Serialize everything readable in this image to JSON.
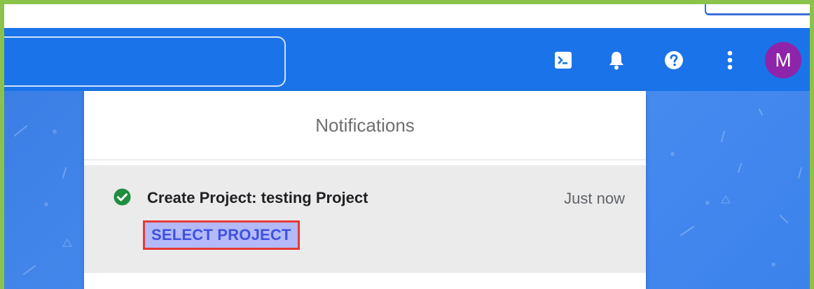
{
  "header": {
    "icons": {
      "terminal": "terminal-icon",
      "notifications": "bell-icon",
      "help": "help-icon",
      "more": "more-vert-icon"
    },
    "avatar_initial": "M",
    "colors": {
      "header": "#1a73e8",
      "avatar": "#8e24aa"
    }
  },
  "notifications": {
    "title": "Notifications",
    "items": [
      {
        "status_icon": "check-circle-icon",
        "status_color": "#1e8e3e",
        "title": "Create Project: testing Project",
        "time": "Just now",
        "action_label": "SELECT PROJECT"
      }
    ]
  },
  "highlight": {
    "color": "#e53935"
  },
  "frame": {
    "color": "#8bc34a"
  }
}
